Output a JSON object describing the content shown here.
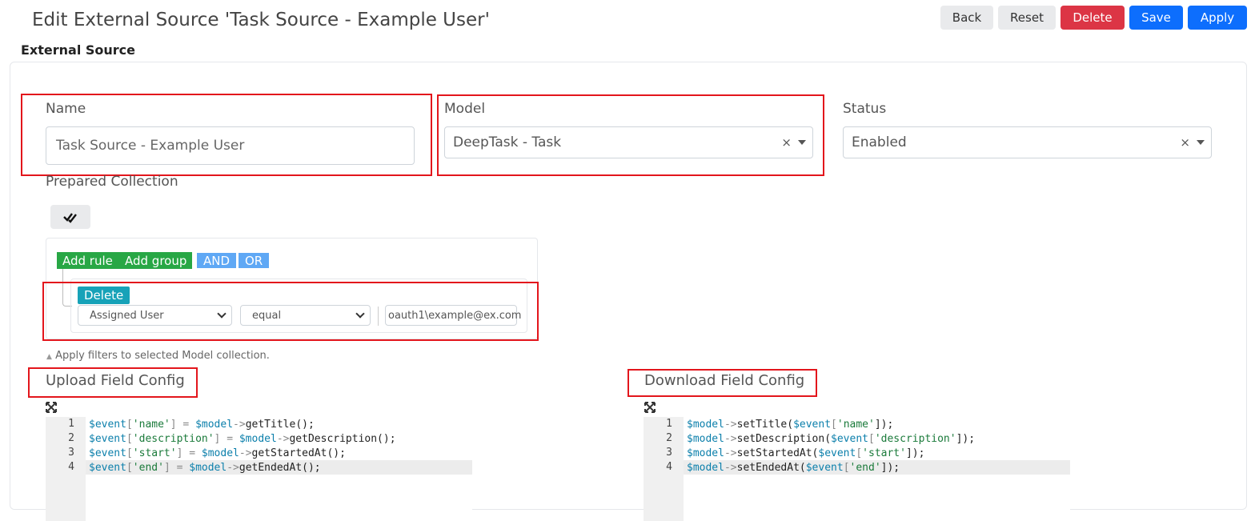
{
  "header": {
    "title": "Edit External Source 'Task Source - Example User'",
    "buttons": {
      "back": "Back",
      "reset": "Reset",
      "delete": "Delete",
      "save": "Save",
      "apply": "Apply"
    }
  },
  "section_title": "External Source",
  "form": {
    "name_label": "Name",
    "name_value": "Task Source - Example User",
    "model_label": "Model",
    "model_value": "DeepTask - Task",
    "status_label": "Status",
    "status_value": "Enabled",
    "clear_glyph": "×",
    "prepared_collection_label": "Prepared Collection"
  },
  "query_builder": {
    "add_rule": "Add rule",
    "add_group": "Add group",
    "and": "AND",
    "or": "OR",
    "delete": "Delete",
    "field": "Assigned User",
    "operator": "equal",
    "value": "oauth1\\example@ex.com",
    "hint": "Apply filters to selected Model collection."
  },
  "upload": {
    "title": "Upload Field Config",
    "line_numbers": [
      "1",
      "2",
      "3",
      "4"
    ],
    "lines": [
      [
        [
          "var",
          "$event"
        ],
        [
          "op",
          "["
        ],
        [
          "str",
          "'name'"
        ],
        [
          "op",
          "] = "
        ],
        [
          "var",
          "$model"
        ],
        [
          "op",
          "->"
        ],
        [
          "plain",
          "getTitle();"
        ]
      ],
      [
        [
          "var",
          "$event"
        ],
        [
          "op",
          "["
        ],
        [
          "str",
          "'description'"
        ],
        [
          "op",
          "] = "
        ],
        [
          "var",
          "$model"
        ],
        [
          "op",
          "->"
        ],
        [
          "plain",
          "getDescription();"
        ]
      ],
      [
        [
          "var",
          "$event"
        ],
        [
          "op",
          "["
        ],
        [
          "str",
          "'start'"
        ],
        [
          "op",
          "] = "
        ],
        [
          "var",
          "$model"
        ],
        [
          "op",
          "->"
        ],
        [
          "plain",
          "getStartedAt();"
        ]
      ],
      [
        [
          "var",
          "$event"
        ],
        [
          "op",
          "["
        ],
        [
          "str",
          "'end'"
        ],
        [
          "op",
          "] = "
        ],
        [
          "var",
          "$model"
        ],
        [
          "op",
          "->"
        ],
        [
          "plain",
          "getEndedAt();"
        ]
      ]
    ]
  },
  "download": {
    "title": "Download Field Config",
    "line_numbers": [
      "1",
      "2",
      "3",
      "4"
    ],
    "lines": [
      [
        [
          "var",
          "$model"
        ],
        [
          "op",
          "->"
        ],
        [
          "plain",
          "setTitle("
        ],
        [
          "var",
          "$event"
        ],
        [
          "op",
          "["
        ],
        [
          "str",
          "'name'"
        ],
        [
          "plain",
          "]);"
        ]
      ],
      [
        [
          "var",
          "$model"
        ],
        [
          "op",
          "->"
        ],
        [
          "plain",
          "setDescription("
        ],
        [
          "var",
          "$event"
        ],
        [
          "op",
          "["
        ],
        [
          "str",
          "'description'"
        ],
        [
          "plain",
          "]);"
        ]
      ],
      [
        [
          "var",
          "$model"
        ],
        [
          "op",
          "->"
        ],
        [
          "plain",
          "setStartedAt("
        ],
        [
          "var",
          "$event"
        ],
        [
          "op",
          "["
        ],
        [
          "str",
          "'start'"
        ],
        [
          "plain",
          "]);"
        ]
      ],
      [
        [
          "var",
          "$model"
        ],
        [
          "op",
          "->"
        ],
        [
          "plain",
          "setEndedAt("
        ],
        [
          "var",
          "$event"
        ],
        [
          "op",
          "["
        ],
        [
          "str",
          "'end'"
        ],
        [
          "plain",
          "]);"
        ]
      ]
    ]
  },
  "colors": {
    "highlight_border": "#e3161c",
    "primary": "#0d6efd",
    "danger": "#dc3545",
    "success": "#28a745",
    "info": "#17a2b8"
  }
}
